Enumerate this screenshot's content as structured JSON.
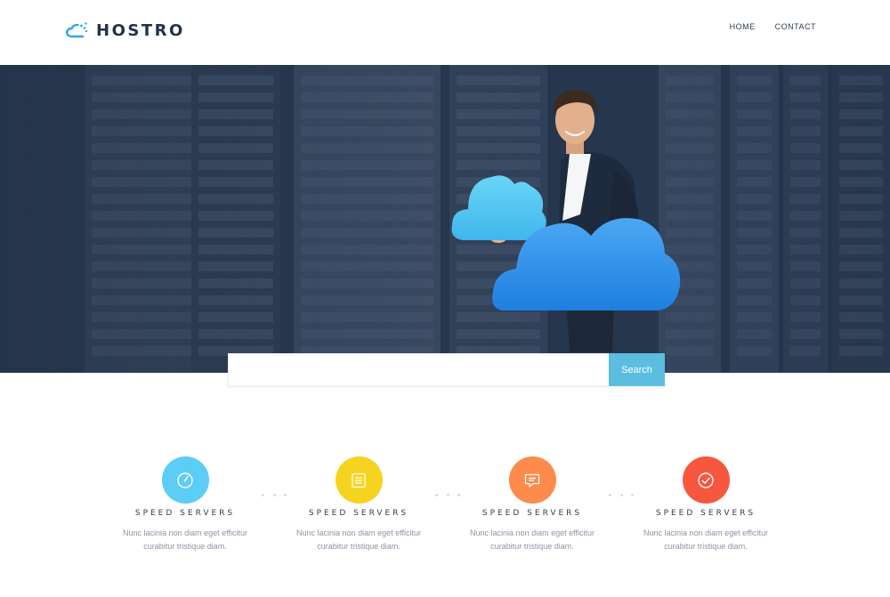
{
  "header": {
    "logo_text": "HOSTRO",
    "logo_icon": "cloud-icon",
    "nav": [
      {
        "label": "HOME"
      },
      {
        "label": "CONTACT"
      }
    ]
  },
  "hero": {
    "background": "server-room-photo",
    "subject": "man-holding-clouds"
  },
  "search": {
    "placeholder": "",
    "value": "",
    "button_label": "Search"
  },
  "features": [
    {
      "icon": "speedometer-icon",
      "color": "#5ccdf6",
      "title": "SPEED SERVERS",
      "line1": "Nunc lacinia non diam eget efficitur",
      "line2": "curabitur tristique diam."
    },
    {
      "icon": "list-icon",
      "color": "#f6d31f",
      "title": "SPEED SERVERS",
      "line1": "Nunc lacinia non diam eget efficitur",
      "line2": "curabitur tristique diam."
    },
    {
      "icon": "chat-icon",
      "color": "#fd8b4c",
      "title": "SPEED SERVERS",
      "line1": "Nunc lacinia non diam eget efficitur",
      "line2": "curabitur tristique diam."
    },
    {
      "icon": "check-circle-icon",
      "color": "#f6573e",
      "title": "SPEED SERVERS",
      "line1": "Nunc lacinia non diam eget efficitur",
      "line2": "curabitur tristique diam."
    }
  ],
  "colors": {
    "brand": "#223349",
    "accent": "#5bbde0",
    "hero_bg": "#27374d"
  }
}
